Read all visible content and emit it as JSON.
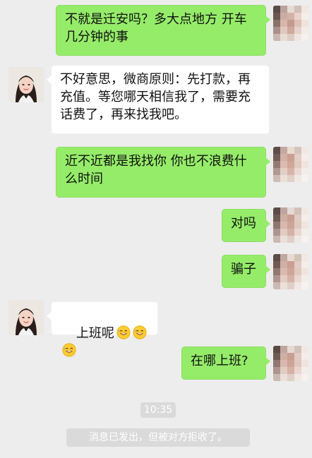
{
  "messages": [
    {
      "side": "sent",
      "text": "不就是迁安吗？多大点地方 开车几分钟的事"
    },
    {
      "side": "recv",
      "text": "不好意思，微商原则：先打款，再充值。等您哪天相信我了，需要充话费了，再来找我吧。"
    },
    {
      "side": "sent",
      "text": "近不近都是我找你 你也不浪费什么时间"
    },
    {
      "side": "sent",
      "text": "对吗"
    },
    {
      "side": "sent",
      "text": "骗子"
    },
    {
      "side": "recv",
      "text": "上班呢",
      "emojis": [
        "grinning-sweat-icon",
        "grinning-sweat-icon",
        "grinning-sweat-icon"
      ]
    },
    {
      "side": "sent",
      "text": "在哪上班?"
    }
  ],
  "system": {
    "time": "10:35",
    "notice": "消息已发出，但被对方拒收了。"
  },
  "colors": {
    "background": "#ededed",
    "sent_bubble": "#95ec69",
    "recv_bubble": "#ffffff",
    "system_pill": "#dadada"
  }
}
